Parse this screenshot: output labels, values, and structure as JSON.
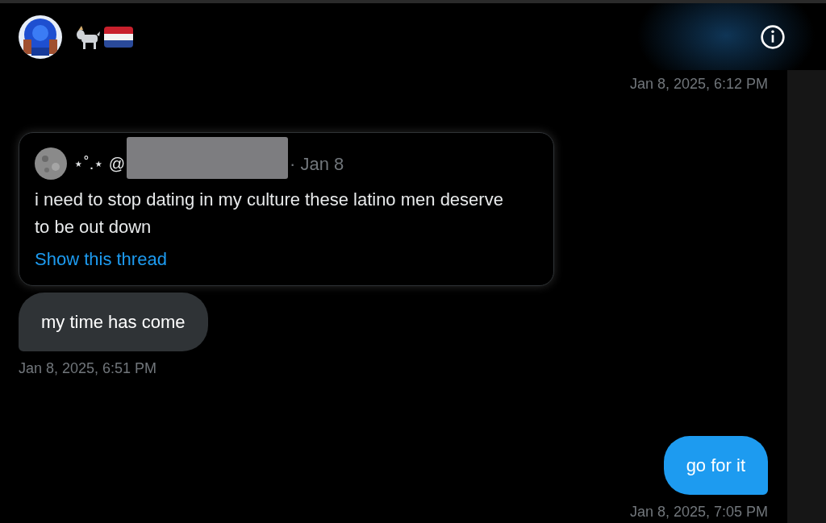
{
  "earlier_timestamp": "Jan 8, 2025, 6:12 PM",
  "groups": [
    {
      "outgoing": false,
      "quote": {
        "author_decoration": "⋆˚.⋆ @",
        "date": "· Jan 8",
        "text": "i need to stop dating in my culture these latino men deserve to be out down",
        "link": "Show this thread"
      },
      "bubbles": [
        "my time has come"
      ],
      "timestamp": "Jan 8, 2025, 6:51 PM"
    },
    {
      "outgoing": true,
      "bubbles": [
        "go for it"
      ],
      "timestamp": "Jan 8, 2025, 7:05 PM"
    }
  ]
}
